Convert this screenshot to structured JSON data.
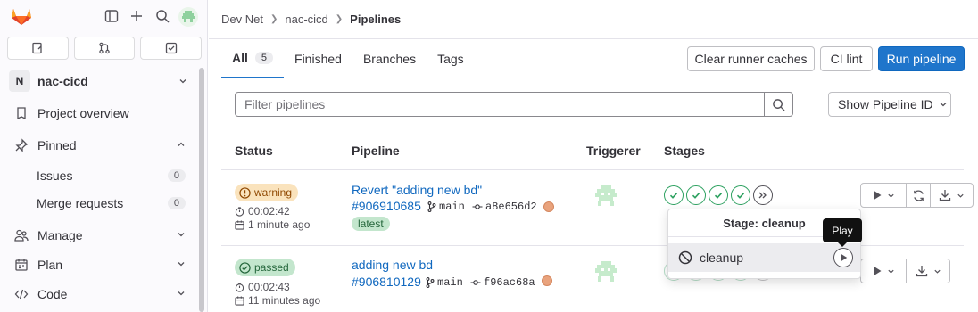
{
  "sidebar": {
    "project_initial": "N",
    "project_name": "nac-cicd",
    "items": [
      {
        "label": "Project overview",
        "icon": "project-icon"
      },
      {
        "label": "Pinned",
        "icon": "thumbtack-icon"
      },
      {
        "label": "Issues",
        "count": "0"
      },
      {
        "label": "Merge requests",
        "count": "0"
      },
      {
        "label": "Manage",
        "icon": "users-icon"
      },
      {
        "label": "Plan",
        "icon": "planning-icon"
      },
      {
        "label": "Code",
        "icon": "code-icon"
      }
    ]
  },
  "breadcrumb": [
    "Dev Net",
    "nac-cicd",
    "Pipelines"
  ],
  "tabs": {
    "all": "All",
    "all_count": "5",
    "finished": "Finished",
    "branches": "Branches",
    "tags": "Tags"
  },
  "actions": {
    "clear_caches": "Clear runner caches",
    "ci_lint": "CI lint",
    "run_pipeline": "Run pipeline"
  },
  "filter": {
    "placeholder": "Filter pipelines",
    "show_id": "Show Pipeline ID"
  },
  "table": {
    "headers": [
      "Status",
      "Pipeline",
      "Triggerer",
      "Stages"
    ]
  },
  "pipelines": [
    {
      "status": "warning",
      "duration": "00:02:42",
      "finished": "1 minute ago",
      "title": "Revert \"adding new bd\"",
      "id": "#906910685",
      "branch": "main",
      "commit": "a8e656d2",
      "tag": "latest"
    },
    {
      "status": "passed",
      "duration": "00:02:43",
      "finished": "11 minutes ago",
      "title": "adding new bd",
      "id": "#906810129",
      "branch": "main",
      "commit": "f96ac68a"
    }
  ],
  "stage_dropdown": {
    "header": "Stage: cleanup",
    "job": "cleanup",
    "tooltip": "Play"
  },
  "colors": {
    "primary": "#1f75cb",
    "success": "#2da160",
    "warning_bg": "#fae3bd",
    "passed_bg": "#c3e6cd"
  }
}
